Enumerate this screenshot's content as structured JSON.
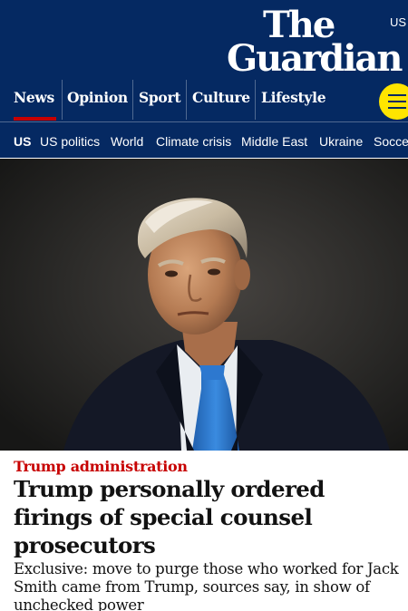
{
  "header": {
    "edition": "US",
    "logo": {
      "line1": "The",
      "line2": "Guardian"
    },
    "pillars": [
      {
        "label": "News",
        "active": true
      },
      {
        "label": "Opinion",
        "active": false
      },
      {
        "label": "Sport",
        "active": false
      },
      {
        "label": "Culture",
        "active": false
      },
      {
        "label": "Lifestyle",
        "active": false
      }
    ],
    "menu_icon": "hamburger-icon",
    "subnav": [
      "US",
      "US politics",
      "World",
      "Climate crisis",
      "Middle East",
      "Ukraine",
      "Soccer"
    ]
  },
  "article": {
    "kicker": "Trump administration",
    "headline": "Trump personally ordered firings of special counsel prosecutors",
    "standfirst": "Exclusive: move to purge those who worked for Jack Smith came from Trump, sources say, in show of unchecked power"
  },
  "colors": {
    "brand": "#052962",
    "accent_red": "#c70000",
    "menu_button": "#ffe500",
    "tie": "#2f7fd8"
  }
}
